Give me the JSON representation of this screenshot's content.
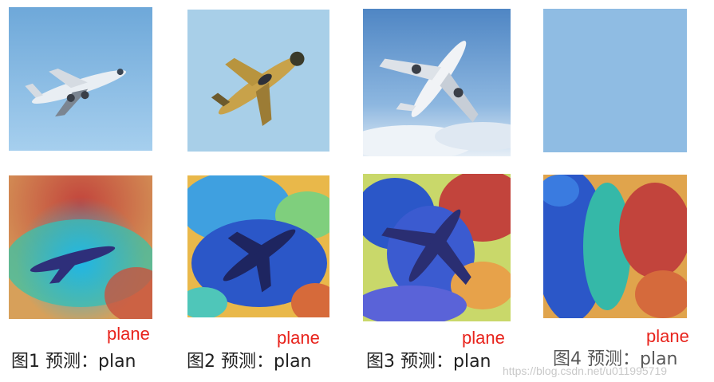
{
  "figures": [
    {
      "caption": "图1 预测：plan",
      "annotation": "plane",
      "heatmap": "warm-top"
    },
    {
      "caption": "图2 预测：plan",
      "annotation": "plane",
      "heatmap": "cool-center"
    },
    {
      "caption": "图3 预测：plan",
      "annotation": "plane",
      "heatmap": "mixed"
    },
    {
      "caption": "图4 预测：plan",
      "annotation": "plane",
      "heatmap": "right-warm"
    }
  ],
  "watermark": "https://blog.csdn.net/u011995719",
  "colors": {
    "annotation": "#e8231c",
    "sky": "#9cc6e6",
    "heat_hot": "#c2443c",
    "heat_cold": "#2b57c8"
  }
}
